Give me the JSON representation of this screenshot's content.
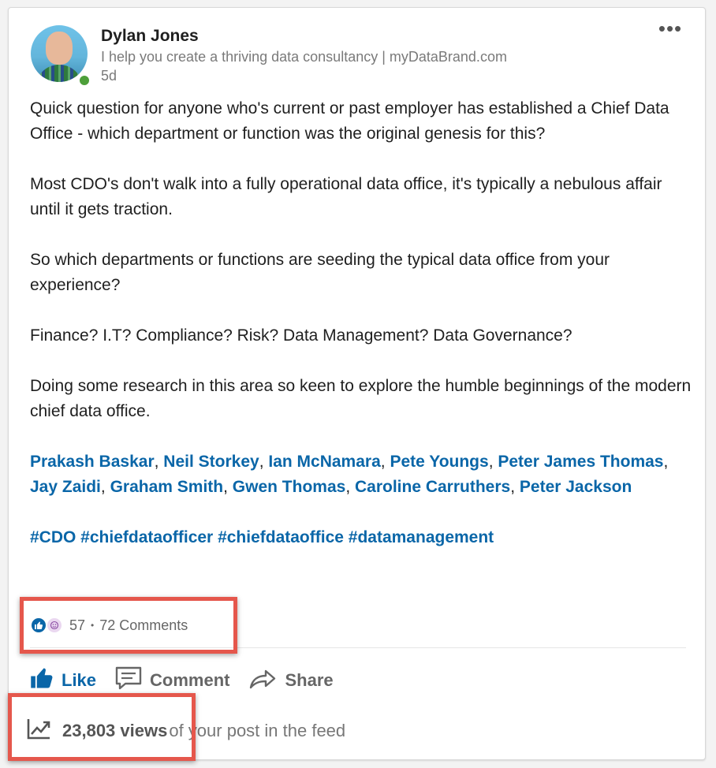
{
  "post": {
    "author": {
      "name": "Dylan Jones",
      "tagline": "I help you create a thriving data consultancy | myDataBrand.com",
      "age": "5d"
    },
    "more_menu": "•••",
    "paragraphs": [
      "Quick question for anyone who's current or past employer has established a Chief Data Office - which department or function was the original genesis for this?",
      "Most CDO's don't walk into a fully operational data office, it's typically a nebulous affair until it gets traction.",
      "So which departments or functions are seeding the typical data office from your experience?",
      "Finance? I.T? Compliance? Risk? Data Management? Data Governance?",
      "Doing some research in this area so keen to explore the humble beginnings of the modern chief data office."
    ],
    "mentions": [
      "Prakash Baskar",
      "Neil Storkey",
      "Ian McNamara",
      "Pete Youngs",
      "Peter James Thomas",
      "Jay Zaidi",
      "Graham Smith",
      "Gwen Thomas",
      "Caroline Carruthers",
      "Peter Jackson"
    ],
    "mention_separator": ", ",
    "hashtags": "#CDO #chiefdataofficer #chiefdataoffice #datamanagement"
  },
  "social": {
    "reaction_count": "57",
    "dot": "•",
    "comments": "72 Comments"
  },
  "actions": {
    "like": "Like",
    "comment": "Comment",
    "share": "Share"
  },
  "views": {
    "count": "23,803 views",
    "suffix": "of your post in the feed"
  },
  "colors": {
    "link": "#0a66a8",
    "highlight": "#e5574c",
    "presence": "#4d9f3a"
  }
}
